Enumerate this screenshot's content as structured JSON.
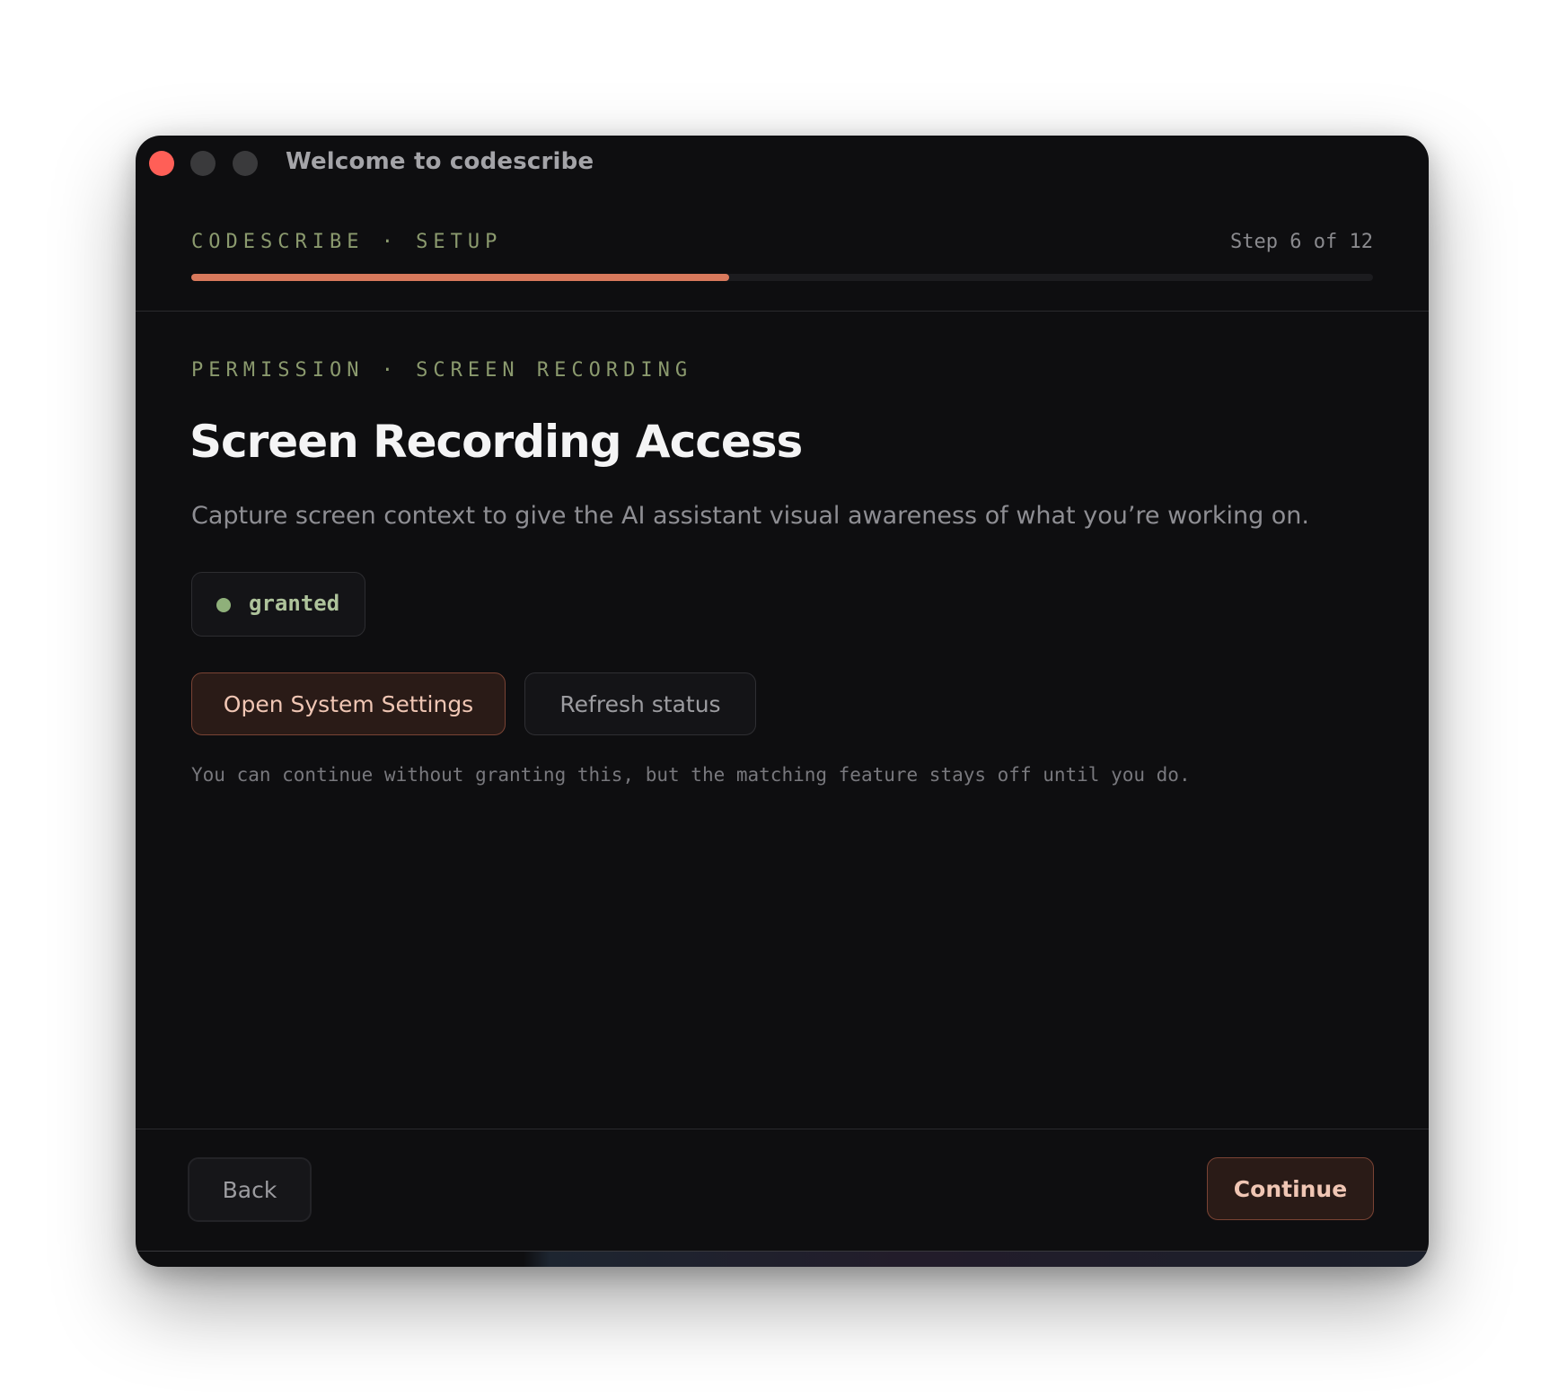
{
  "window": {
    "title": "Welcome to codescribe"
  },
  "header": {
    "kicker": "CODESCRIBE · SETUP",
    "step": "Step 6 of 12",
    "progress": 0.455,
    "accent_color": "#d8795c"
  },
  "permission": {
    "kicker": "PERMISSION · SCREEN RECORDING",
    "title": "Screen Recording Access",
    "description": "Capture screen context to give the AI assistant visual awareness of what you’re working on.",
    "status": "granted",
    "status_color": "#8fb07a",
    "open_settings_label": "Open System Settings",
    "refresh_label": "Refresh status",
    "hint": "You can continue without granting this, but the matching feature stays off until you do."
  },
  "footer": {
    "back_label": "Back",
    "continue_label": "Continue"
  }
}
